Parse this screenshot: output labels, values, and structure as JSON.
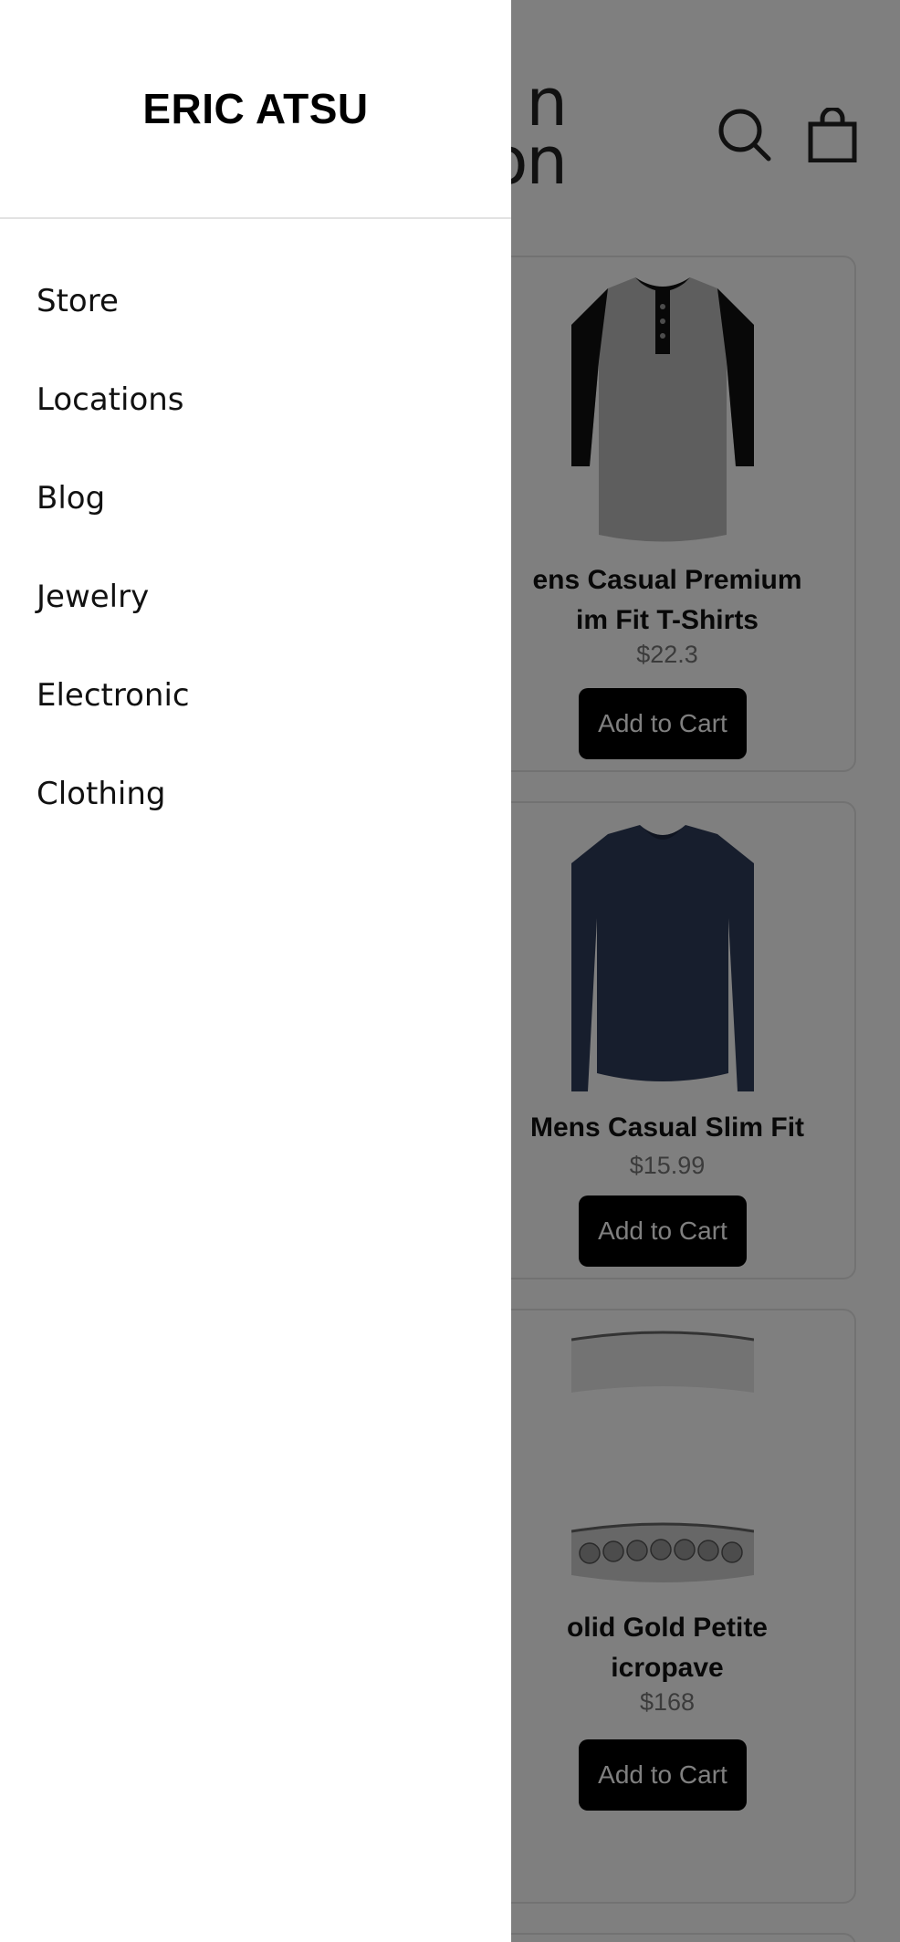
{
  "header": {
    "logo_line1": "n",
    "logo_line2": "on"
  },
  "icons": {
    "search": "search-icon",
    "bag": "shopping-bag-icon"
  },
  "products": [
    {
      "title_line1": "ens Casual Premium",
      "title_line2": "im Fit T-Shirts",
      "price": "$22.3",
      "button": "Add to Cart"
    },
    {
      "title_line1": "Mens Casual Slim Fit",
      "title_line2": "",
      "price": "$15.99",
      "button": "Add to Cart"
    },
    {
      "title_line1": "olid Gold Petite",
      "title_line2": "icropave",
      "price": "$168",
      "button": "Add to Cart"
    }
  ],
  "drawer": {
    "title": "ERIC ATSU",
    "items": [
      {
        "label": "Store"
      },
      {
        "label": "Locations"
      },
      {
        "label": "Blog"
      },
      {
        "label": "Jewelry"
      },
      {
        "label": "Electronic"
      },
      {
        "label": "Clothing"
      }
    ]
  },
  "colors": {
    "scrim": "rgba(0,0,0,0.5)",
    "button_bg": "#000000",
    "drawer_bg": "#ffffff"
  }
}
